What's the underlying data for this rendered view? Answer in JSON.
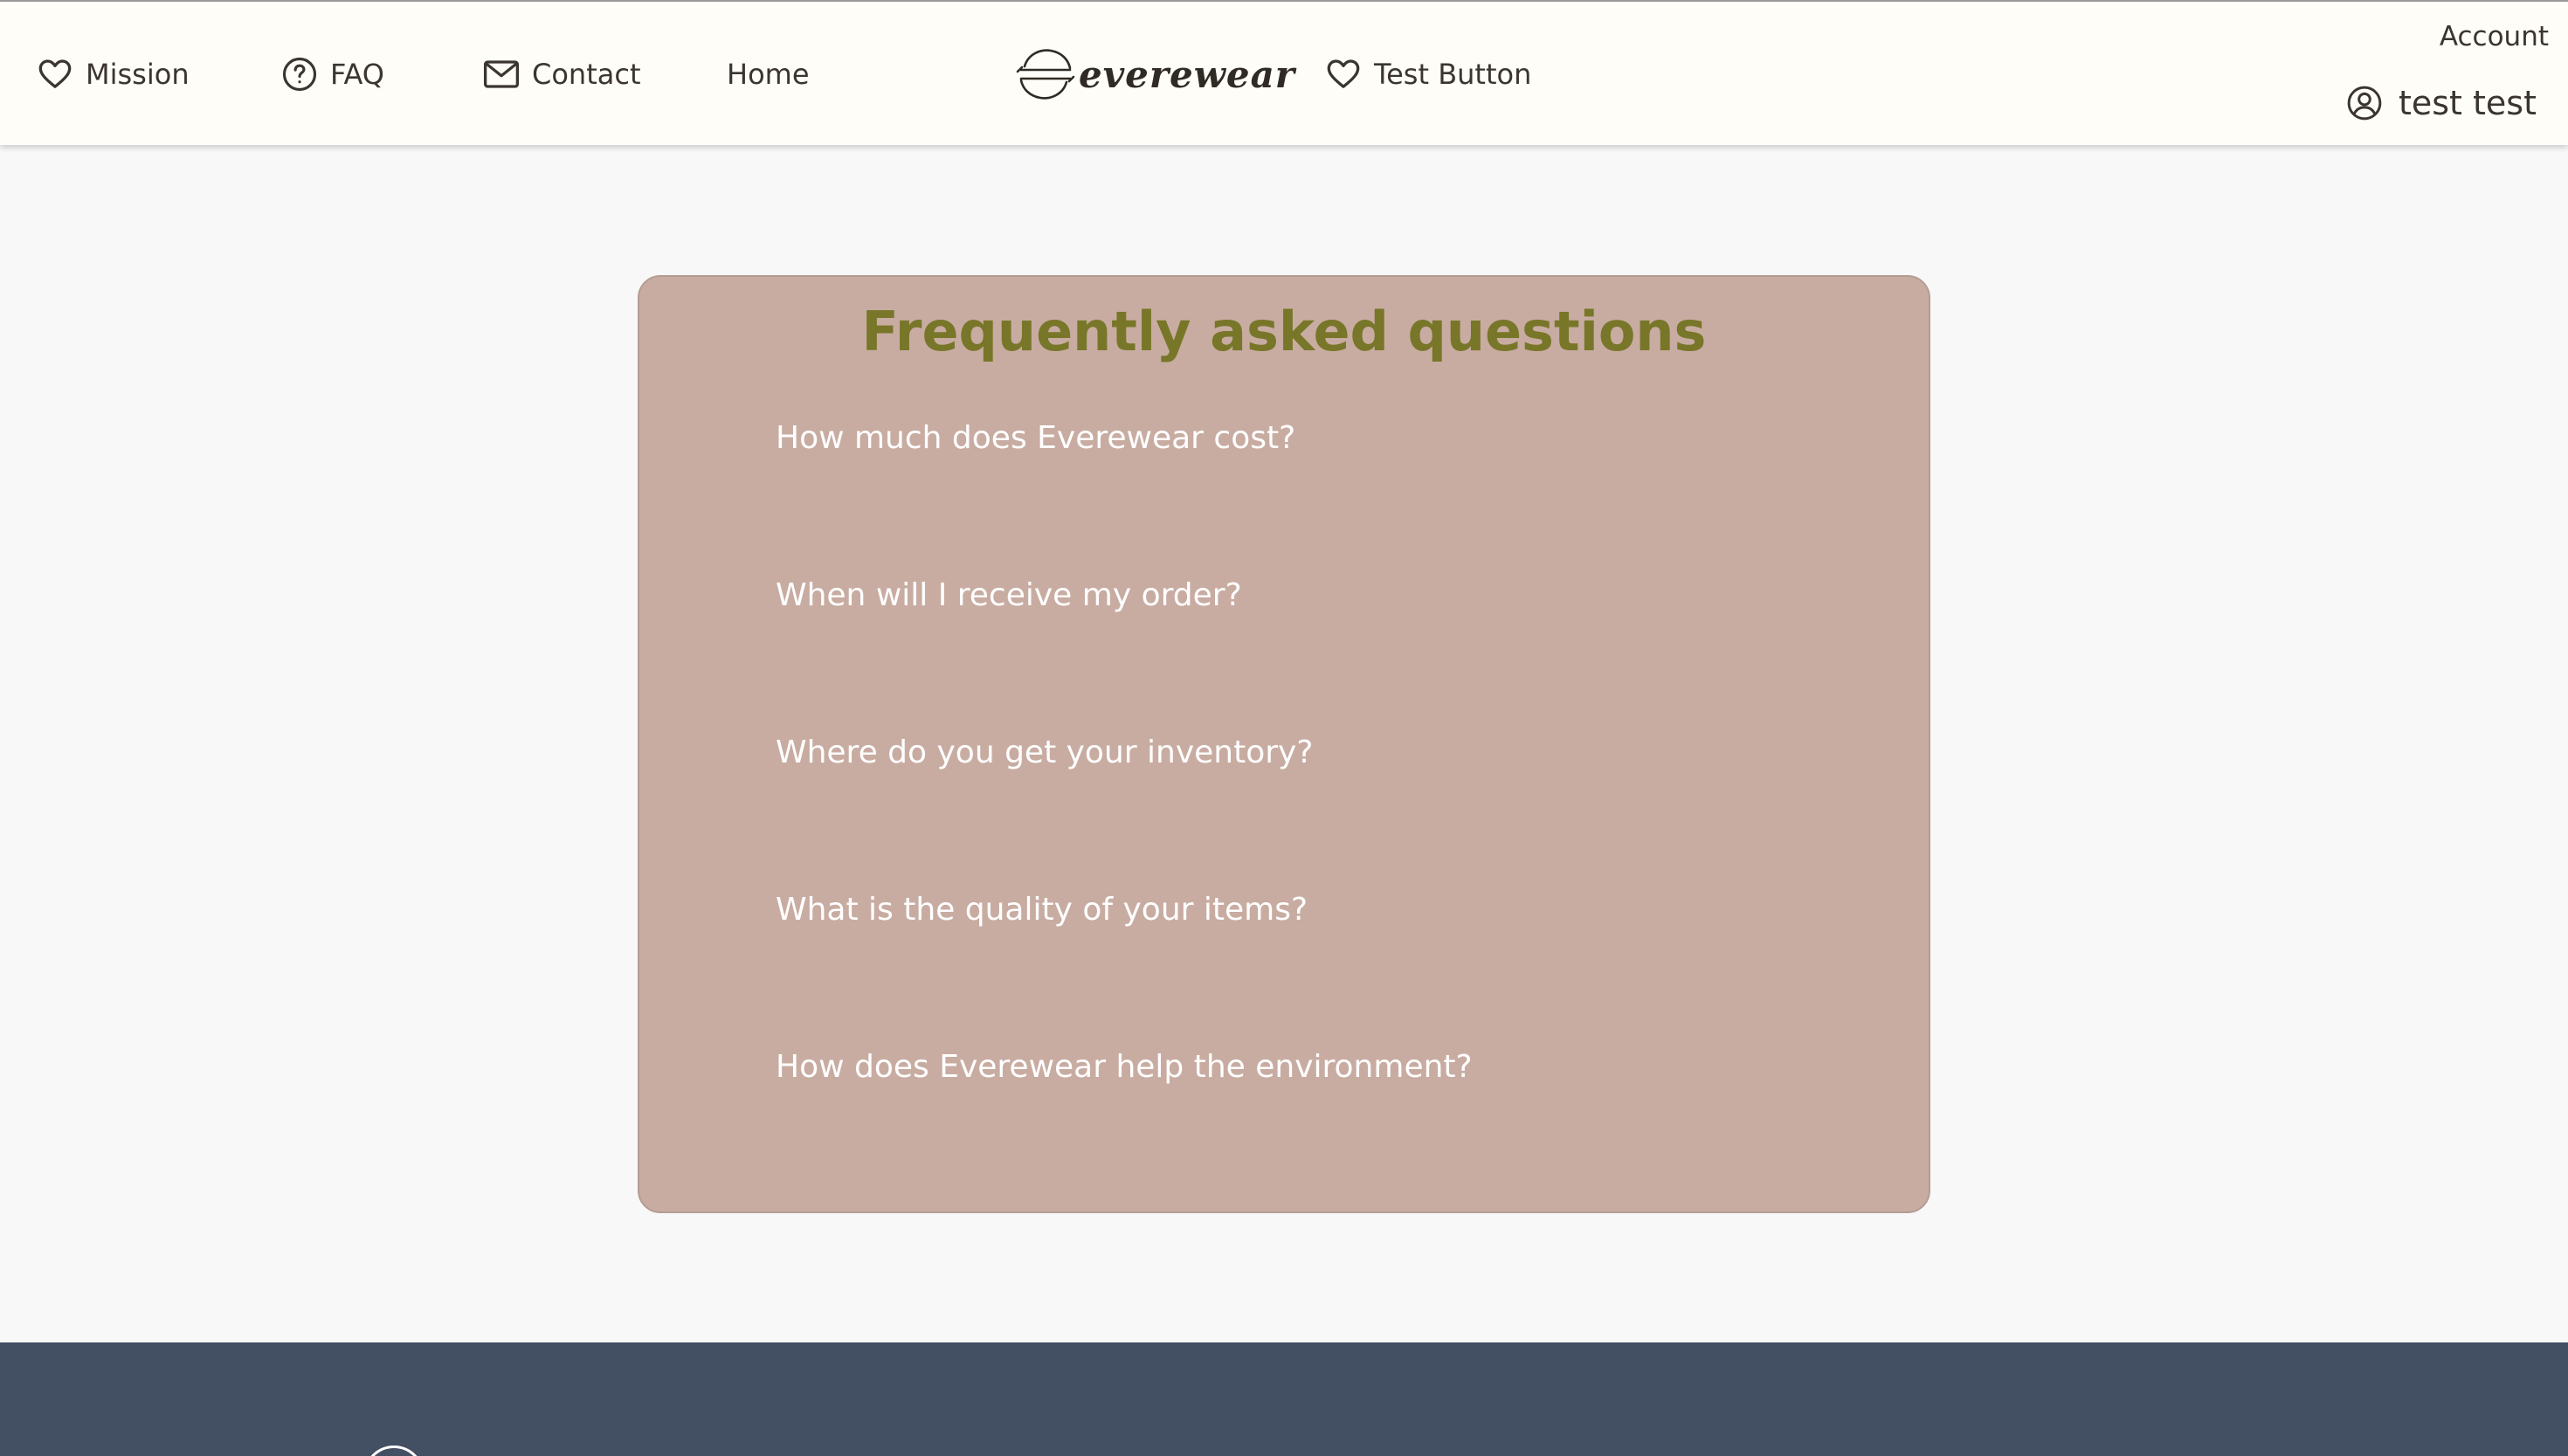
{
  "header": {
    "nav": [
      {
        "label": "Mission",
        "icon": "heart-icon"
      },
      {
        "label": "FAQ",
        "icon": "question-circle-icon"
      },
      {
        "label": "Contact",
        "icon": "mail-icon"
      },
      {
        "label": "Home",
        "icon": ""
      }
    ],
    "brand": {
      "name": "everewear",
      "icon": "everewear-logo-icon"
    },
    "test_button": {
      "label": "Test Button",
      "icon": "heart-icon"
    },
    "account": {
      "label": "Account",
      "user_name": "test test",
      "icon": "user-circle-icon"
    }
  },
  "faq": {
    "title": "Frequently asked questions",
    "questions": [
      "How much does Everewear cost?",
      "When will I receive my order?",
      "Where do you get your inventory?",
      "What is the quality of your items?",
      "How does Everewear help the environment?"
    ]
  },
  "colors": {
    "header_bg": "#fffdf8",
    "page_bg": "#f8f8f8",
    "card_bg": "#c8aca2",
    "title_color": "#787628",
    "question_color": "#ffffff",
    "footer_bg": "#434f63",
    "text_dark": "#3b3530"
  }
}
